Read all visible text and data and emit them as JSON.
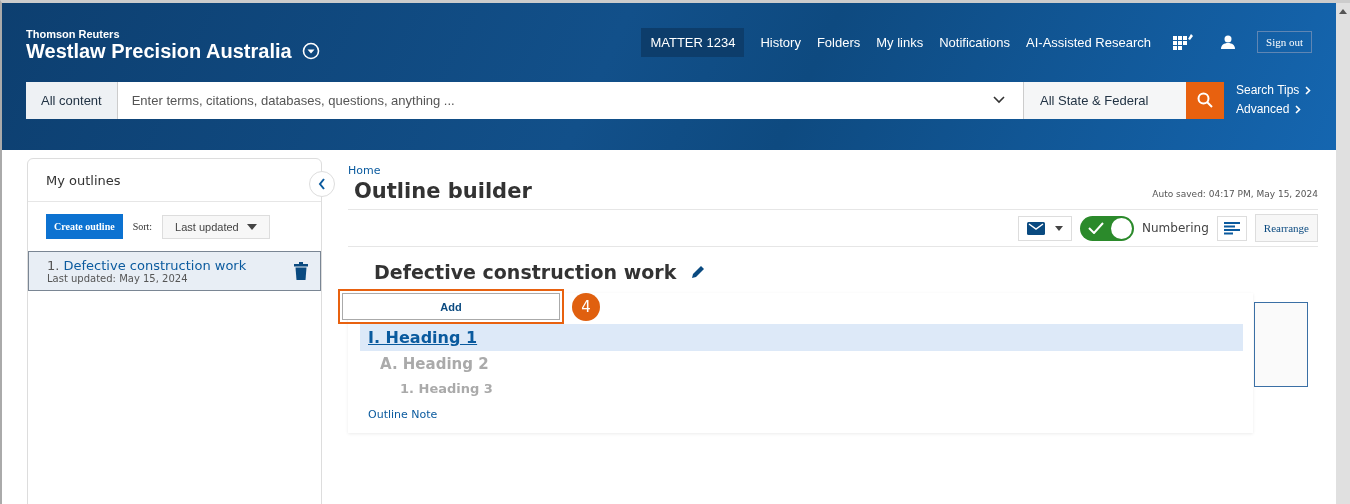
{
  "brand": {
    "company": "Thomson Reuters",
    "product": "Westlaw Precision Australia"
  },
  "nav": [
    {
      "label": "MATTER 1234",
      "kind": "matter"
    },
    {
      "label": "History",
      "kind": "link"
    },
    {
      "label": "Folders",
      "kind": "link"
    },
    {
      "label": "My links",
      "kind": "link"
    },
    {
      "label": "Notifications",
      "kind": "link"
    },
    {
      "label": "AI-Assisted Research",
      "kind": "link"
    }
  ],
  "sign_out": "Sign out",
  "search": {
    "scope": "All content",
    "placeholder": "Enter terms, citations, databases, questions, anything ...",
    "jurisdiction": "All State & Federal",
    "links": [
      "Search Tips",
      "Advanced"
    ]
  },
  "sidebar": {
    "title": "My outlines",
    "create_button": "Create outline",
    "sort_label": "Sort:",
    "sort_value": "Last updated",
    "items": [
      {
        "number": "1.",
        "title": "Defective construction work",
        "updated": "Last updated: May 15, 2024",
        "selected": true
      }
    ]
  },
  "breadcrumb": "Home",
  "page_title": "Outline builder",
  "auto_saved": "Auto saved: 04:17 PM, May 15, 2024",
  "toolbar": {
    "numbering": {
      "label": "Numbering",
      "on": true
    },
    "rearrange": "Rearrange"
  },
  "outline": {
    "title": "Defective construction work",
    "add_button": "Add",
    "callout": "4",
    "headings": [
      {
        "label": "I. Heading 1",
        "selected": true,
        "children": [
          {
            "label": "A. Heading 2",
            "selected": false,
            "children": [
              {
                "label": "1. Heading 3",
                "selected": false
              }
            ]
          }
        ]
      }
    ],
    "note": "Outline Note"
  }
}
